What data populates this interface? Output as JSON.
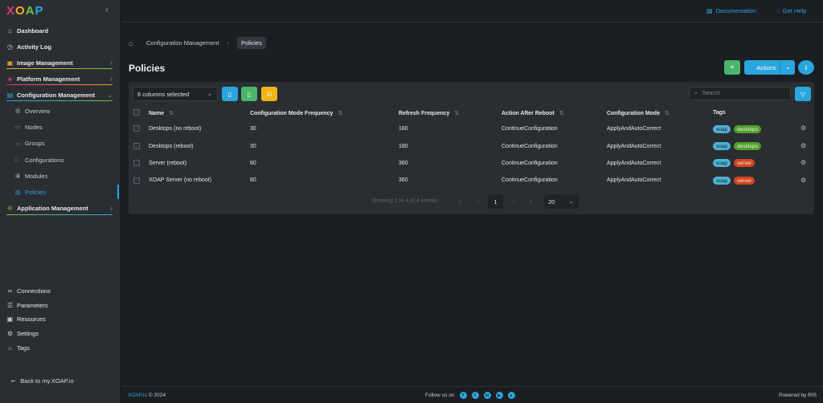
{
  "logo": {
    "letters": [
      "X",
      "O",
      "A",
      "P"
    ]
  },
  "sidebar": {
    "collapse_icon": "chevron-left-icon",
    "items": [
      {
        "label": "Dashboard",
        "icon": "home-icon"
      },
      {
        "label": "Activity Log",
        "icon": "clock-icon"
      },
      {
        "label": "Image Management",
        "icon": "image-icon",
        "accent": "#f3a62b"
      },
      {
        "label": "Platform Management",
        "icon": "platform-icon",
        "accent": "#e2337a"
      },
      {
        "label": "Configuration Management",
        "icon": "config-icon",
        "accent": "#2aa5dd"
      }
    ],
    "subitems": [
      {
        "label": "Overview",
        "icon": "grid-icon"
      },
      {
        "label": "Nodes",
        "icon": "monitor-icon"
      },
      {
        "label": "Groups",
        "icon": "group-icon"
      },
      {
        "label": "Configurations",
        "icon": "file-icon"
      },
      {
        "label": "Modules",
        "icon": "module-icon"
      },
      {
        "label": "Policies",
        "icon": "policy-icon",
        "active": true
      }
    ],
    "app_item": {
      "label": "Application Management",
      "icon": "app-icon",
      "accent": "#6fc043"
    },
    "bottom_items": [
      {
        "label": "Connections",
        "icon": "link-icon"
      },
      {
        "label": "Parameters",
        "icon": "list-icon"
      },
      {
        "label": "Resources",
        "icon": "box-icon"
      },
      {
        "label": "Settings",
        "icon": "gear-icon"
      },
      {
        "label": "Tags",
        "icon": "bookmark-icon"
      }
    ],
    "back_label": "Back to my.XOAP.io"
  },
  "topbar": {
    "documentation": "Documentation",
    "help": "Get Help"
  },
  "breadcrumb": {
    "items": [
      "Configuration Management"
    ],
    "current": "Policies"
  },
  "page": {
    "title": "Policies"
  },
  "toolbar": {
    "add_label": "+",
    "actions_label": "Actions",
    "info_label": "i"
  },
  "table_toolbar": {
    "columns_selected": "6 columns selected",
    "search_placeholder": "Search"
  },
  "table": {
    "columns": [
      "Name",
      "Configuration Mode Frequency",
      "Refresh Frequency",
      "Action After Reboot",
      "Configuration Mode",
      "Tags"
    ],
    "rows": [
      {
        "name": "Desktops (no reboot)",
        "freq": "30",
        "refresh": "180",
        "action": "ContinueConfiguration",
        "mode": "ApplyAndAutoCorrect",
        "tags": [
          "xoap",
          "desktops"
        ]
      },
      {
        "name": "Desktops (reboot)",
        "freq": "30",
        "refresh": "180",
        "action": "ContinueConfiguration",
        "mode": "ApplyAndAutoCorrect",
        "tags": [
          "xoap",
          "desktops"
        ]
      },
      {
        "name": "Server (reboot)",
        "freq": "60",
        "refresh": "360",
        "action": "ContinueConfiguration",
        "mode": "ApplyAndAutoCorrect",
        "tags": [
          "xoap",
          "server"
        ]
      },
      {
        "name": "XOAP Server (no reboot)",
        "freq": "60",
        "refresh": "360",
        "action": "ContinueConfiguration",
        "mode": "ApplyAndAutoCorrect",
        "tags": [
          "xoap",
          "server"
        ]
      }
    ]
  },
  "pagination": {
    "info": "Showing 1 to 4 of 4 entries",
    "current_page": "1",
    "page_size": "20"
  },
  "footer": {
    "brand": "XOAP.io",
    "copyright": "© 2024",
    "follow": "Follow us on",
    "powered": "Powered by RIS"
  },
  "colors": {
    "accent": "#2aa5dd",
    "green": "#49b66b",
    "yellow": "#f2b414",
    "tag_green": "#4fa02a",
    "tag_red": "#d2451f"
  }
}
